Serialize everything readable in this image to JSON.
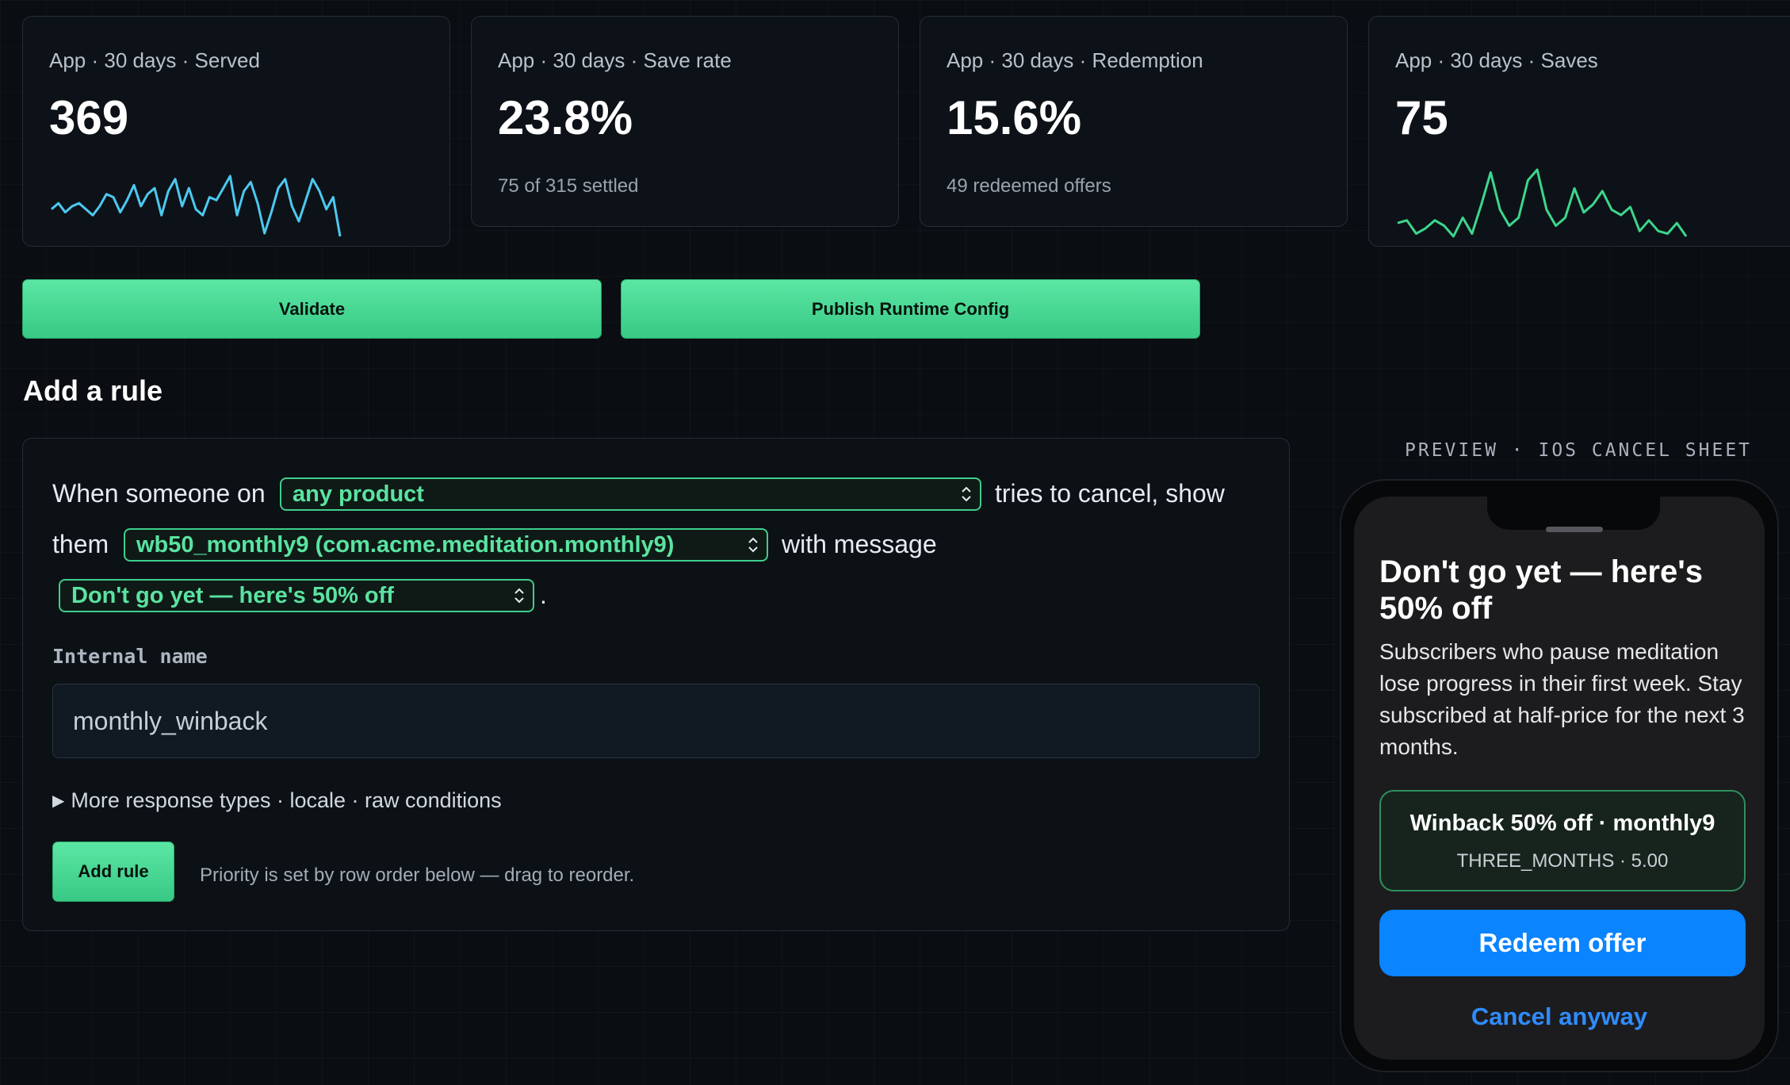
{
  "metrics": [
    {
      "label": "App · 30 days · Served",
      "value": "369",
      "sub": "",
      "spark_color": "#4cc9f0",
      "sparkline": [
        12,
        14,
        11,
        13,
        14,
        12,
        10,
        13,
        17,
        16,
        11,
        15,
        20,
        13,
        17,
        19,
        10,
        18,
        22,
        13,
        19,
        12,
        10,
        16,
        15,
        19,
        23,
        10,
        18,
        21,
        14,
        4,
        11,
        19,
        22,
        13,
        8,
        15,
        22,
        18,
        12,
        16,
        3
      ]
    },
    {
      "label": "App · 30 days · Save rate",
      "value": "23.8%",
      "sub": "75 of 315 settled"
    },
    {
      "label": "App · 30 days · Redemption",
      "value": "15.6%",
      "sub": "49 redeemed offers"
    },
    {
      "label": "App · 30 days · Saves",
      "value": "75",
      "sub": "",
      "spark_color": "#3dd68c",
      "sparkline": [
        9,
        10,
        5,
        7,
        10,
        8,
        4,
        11,
        5,
        16,
        28,
        14,
        8,
        11,
        25,
        29,
        14,
        8,
        11,
        22,
        13,
        16,
        21,
        14,
        12,
        15,
        6,
        10,
        6,
        5,
        9,
        4
      ]
    }
  ],
  "actions": {
    "validate_label": "Validate",
    "publish_label": "Publish Runtime Config"
  },
  "rule_form": {
    "title": "Add a rule",
    "text_when": "When someone on",
    "product_value": "any product",
    "text_tries": "tries to cancel, show",
    "text_them": "them",
    "offer_value": "wb50_monthly9 (com.acme.meditation.monthly9)",
    "text_with": "with message",
    "message_value": "Don't go yet — here's 50% off",
    "text_period": ".",
    "internal_name_label": "Internal name",
    "internal_name_value": "monthly_winback",
    "more_toggle": "More response types · locale · raw conditions",
    "add_rule_label": "Add rule",
    "priority_hint": "Priority is set by row order below — drag to reorder."
  },
  "preview": {
    "caption": "PREVIEW · IOS CANCEL SHEET",
    "title": "Don't go yet — here's 50% off",
    "body": "Subscribers who pause meditation lose progress in their first week. Stay subscribed at half-price for the next 3 months.",
    "offer_title": "Winback 50% off · monthly9",
    "offer_sub": "THREE_MONTHS · 5.00",
    "redeem_label": "Redeem offer",
    "cancel_label": "Cancel anyway",
    "colors": {
      "redeem": "#0a84ff",
      "cancel": "#2f8cff"
    }
  }
}
